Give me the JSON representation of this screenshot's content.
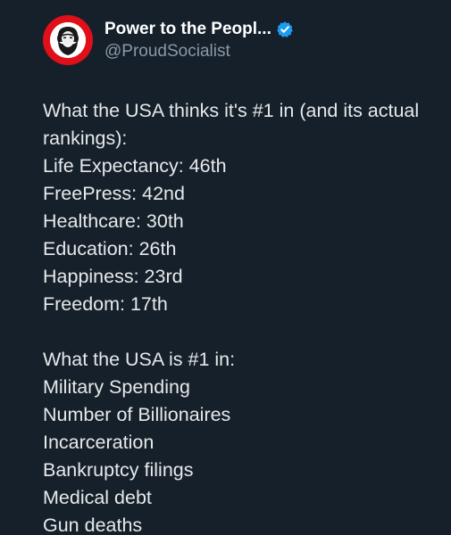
{
  "post": {
    "display_name": "Power to the Peopl...",
    "handle": "@ProudSocialist",
    "verified_icon": "verified-badge-icon",
    "avatar_icon": "portrait-avatar",
    "colors": {
      "background": "#15202b",
      "avatar_ring": "#e0101a",
      "verified": "#1d9bf0",
      "handle": "#8b98a5"
    },
    "section1_heading": "What the USA thinks it's #1 in (and its actual rankings):",
    "section1_items": [
      "Life Expectancy: 46th",
      "FreePress: 42nd",
      "Healthcare: 30th",
      "Education: 26th",
      "Happiness: 23rd",
      "Freedom: 17th"
    ],
    "section2_heading": "What the USA is #1 in:",
    "section2_items": [
      "Military Spending",
      "Number of Billionaires",
      "Incarceration",
      "Bankruptcy filings",
      "Medical debt",
      "Gun deaths"
    ]
  }
}
